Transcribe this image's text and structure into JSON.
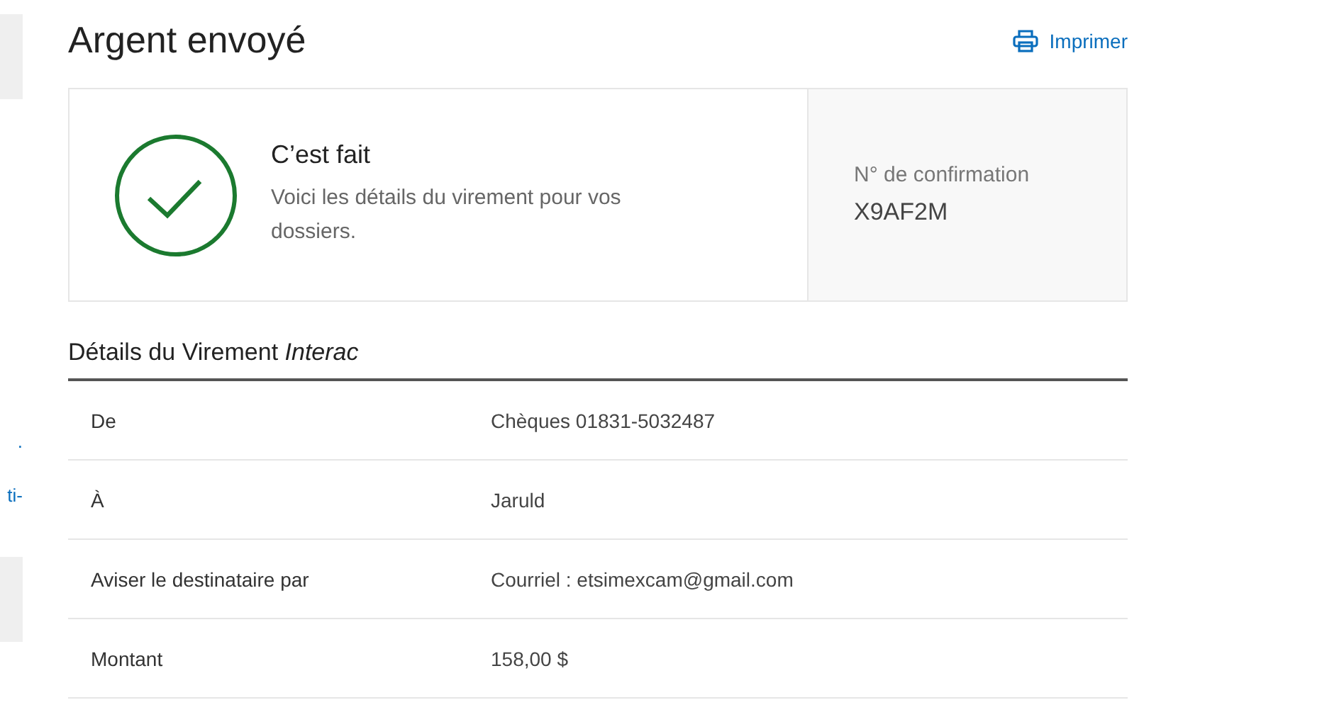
{
  "sidebar": {
    "fragments": [
      {
        "text": "."
      },
      {
        "text": "ti-"
      }
    ]
  },
  "title": "Argent envoyé",
  "print_link": "Imprimer",
  "confirmation": {
    "heading": "C’est fait",
    "message": "Voici les détails du virement pour vos dossiers.",
    "number_label": "N° de confirmation",
    "number": "X9AF2M"
  },
  "details": {
    "heading": "Détails du Virement *Interac*",
    "rows": [
      {
        "label": "De",
        "value": "Chèques 01831-5032487"
      },
      {
        "label": "À",
        "value": "Jaruld"
      },
      {
        "label": "Aviser le destinataire par",
        "value": "Courriel : etsimexcam@gmail.com"
      },
      {
        "label": "Montant",
        "value": "158,00 $"
      }
    ]
  }
}
